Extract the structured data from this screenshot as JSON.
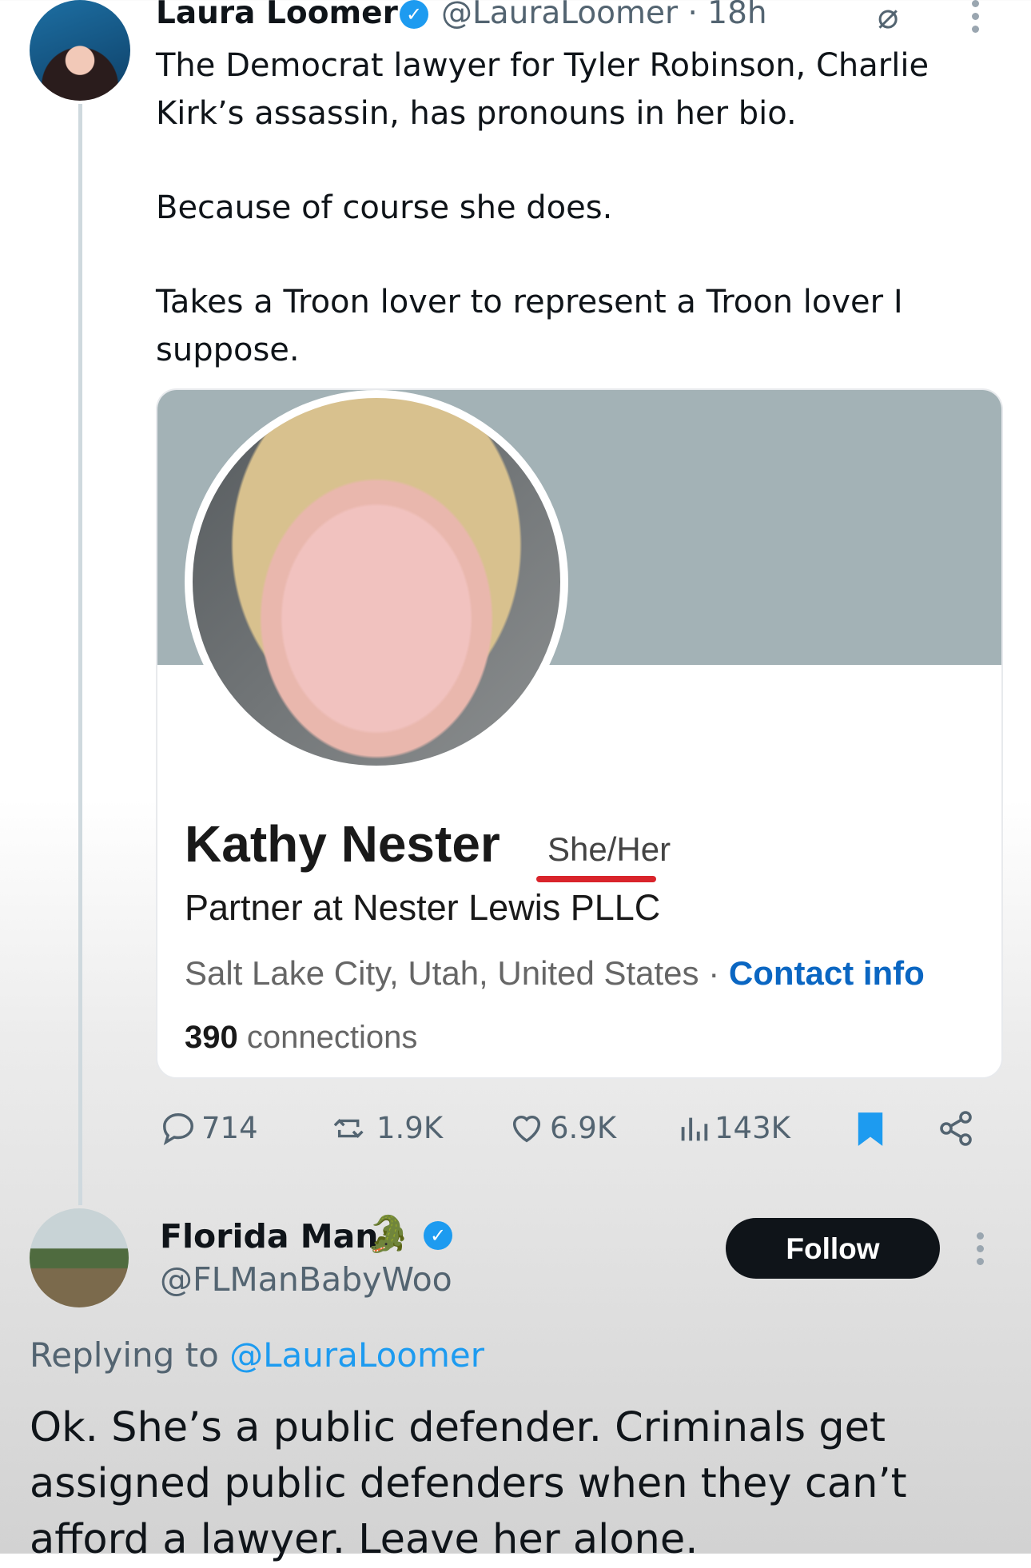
{
  "tweet": {
    "author_name": "Laura Loomer",
    "author_handle": "@LauraLoomer · 18h",
    "paragraph_1": "The Democrat lawyer for Tyler Robinson, Charlie Kirk’s assassin, has pronouns in her bio.",
    "paragraph_2": "Because of course she does.",
    "paragraph_3": "Takes a Troon lover to represent a Troon lover I suppose."
  },
  "card": {
    "name": "Kathy Nester",
    "pronouns": "She/Her",
    "headline": "Partner at Nester Lewis PLLC",
    "location": "Salt Lake City, Utah, United States · ",
    "contact_label": "Contact info",
    "connections_count": "390",
    "connections_label": " connections"
  },
  "actions": {
    "replies": "714",
    "reposts": "1.9K",
    "likes": "6.9K",
    "views": "143K"
  },
  "reply": {
    "author_name": "Florida Man",
    "author_handle": "@FLManBabyWoo",
    "follow_label": "Follow",
    "replying_prefix": "Replying to ",
    "replying_handle": "@LauraLoomer",
    "text": "Ok. She’s a public defender. Criminals get assigned public defenders when they can’t afford a lawyer. Leave her alone."
  },
  "colors": {
    "accent": "#1d9bf0",
    "linkedin_blue": "#0a66c2",
    "underline_red": "#d9242b",
    "banner": "#a3b2b6"
  },
  "icons": [
    "grok-icon",
    "more-icon",
    "reply-icon",
    "repost-icon",
    "like-icon",
    "views-icon",
    "bookmark-icon",
    "share-icon",
    "verified-icon",
    "gator-icon"
  ]
}
